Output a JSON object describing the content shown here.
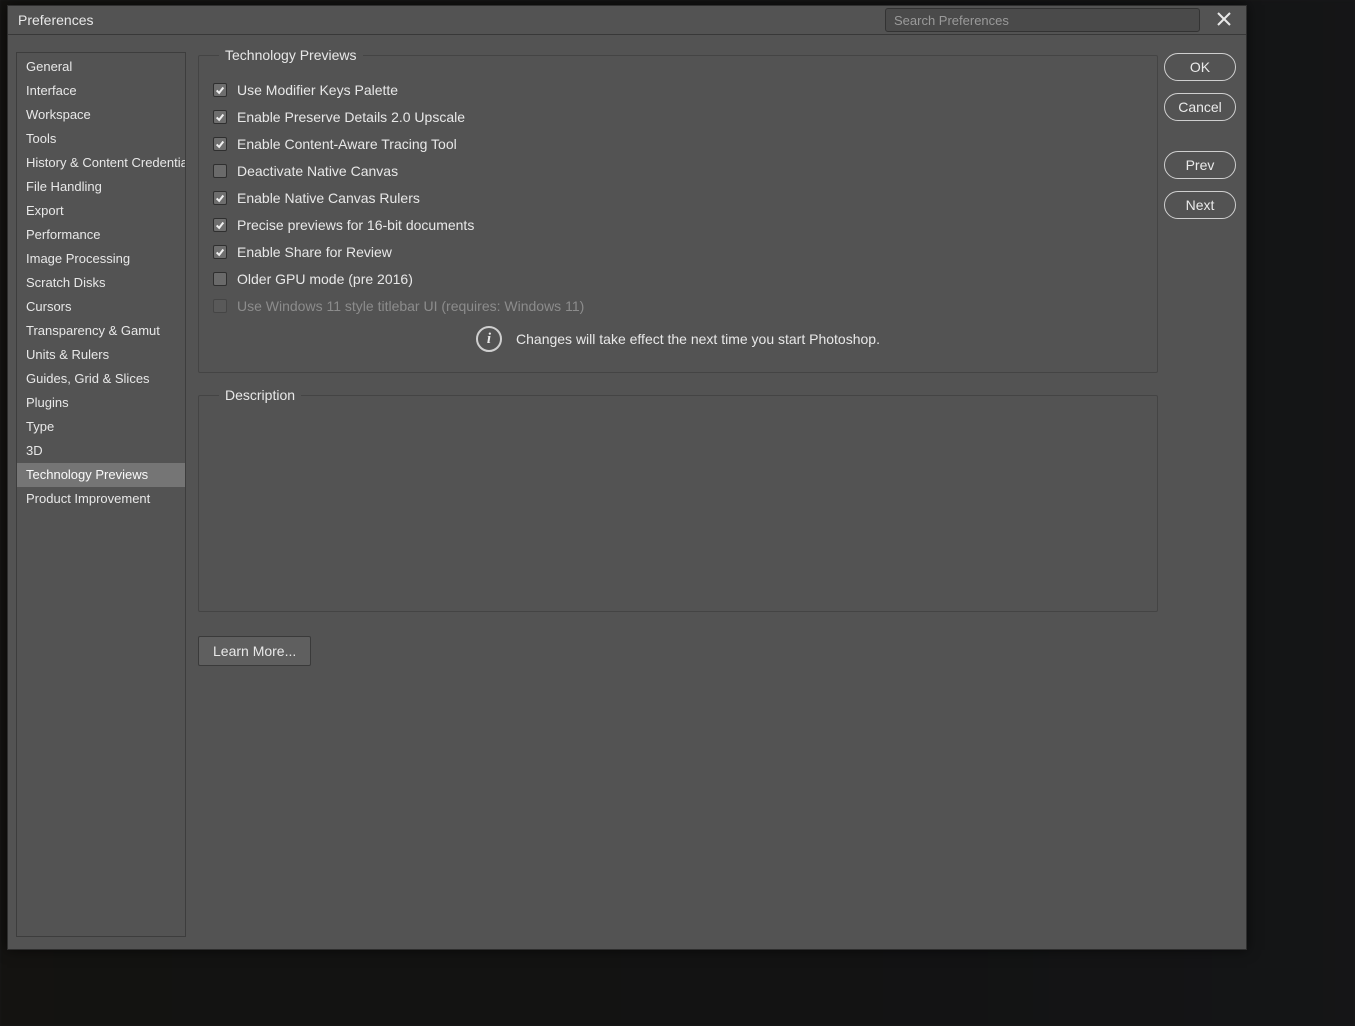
{
  "dialog": {
    "title": "Preferences",
    "search_placeholder": "Search Preferences"
  },
  "sidebar": {
    "items": [
      {
        "label": "General"
      },
      {
        "label": "Interface"
      },
      {
        "label": "Workspace"
      },
      {
        "label": "Tools"
      },
      {
        "label": "History & Content Credentials"
      },
      {
        "label": "File Handling"
      },
      {
        "label": "Export"
      },
      {
        "label": "Performance"
      },
      {
        "label": "Image Processing"
      },
      {
        "label": "Scratch Disks"
      },
      {
        "label": "Cursors"
      },
      {
        "label": "Transparency & Gamut"
      },
      {
        "label": "Units & Rulers"
      },
      {
        "label": "Guides, Grid & Slices"
      },
      {
        "label": "Plugins"
      },
      {
        "label": "Type"
      },
      {
        "label": "3D"
      },
      {
        "label": "Technology Previews",
        "selected": true
      },
      {
        "label": "Product Improvement"
      }
    ]
  },
  "tech_previews": {
    "legend": "Technology Previews",
    "options": [
      {
        "label": "Use Modifier Keys Palette",
        "checked": true
      },
      {
        "label": "Enable Preserve Details 2.0 Upscale",
        "checked": true
      },
      {
        "label": "Enable Content-Aware Tracing Tool",
        "checked": true
      },
      {
        "label": "Deactivate Native Canvas",
        "checked": false
      },
      {
        "label": "Enable Native Canvas Rulers",
        "checked": true
      },
      {
        "label": "Precise previews for 16-bit documents",
        "checked": true
      },
      {
        "label": "Enable Share for Review",
        "checked": true
      },
      {
        "label": "Older GPU mode (pre 2016)",
        "checked": false
      },
      {
        "label": "Use Windows 11 style titlebar UI  (requires: Windows 11)",
        "checked": false,
        "disabled": true
      }
    ],
    "info_text": "Changes will take effect the next time you start Photoshop."
  },
  "description": {
    "legend": "Description"
  },
  "buttons": {
    "ok": "OK",
    "cancel": "Cancel",
    "prev": "Prev",
    "next": "Next",
    "learn_more": "Learn More..."
  }
}
